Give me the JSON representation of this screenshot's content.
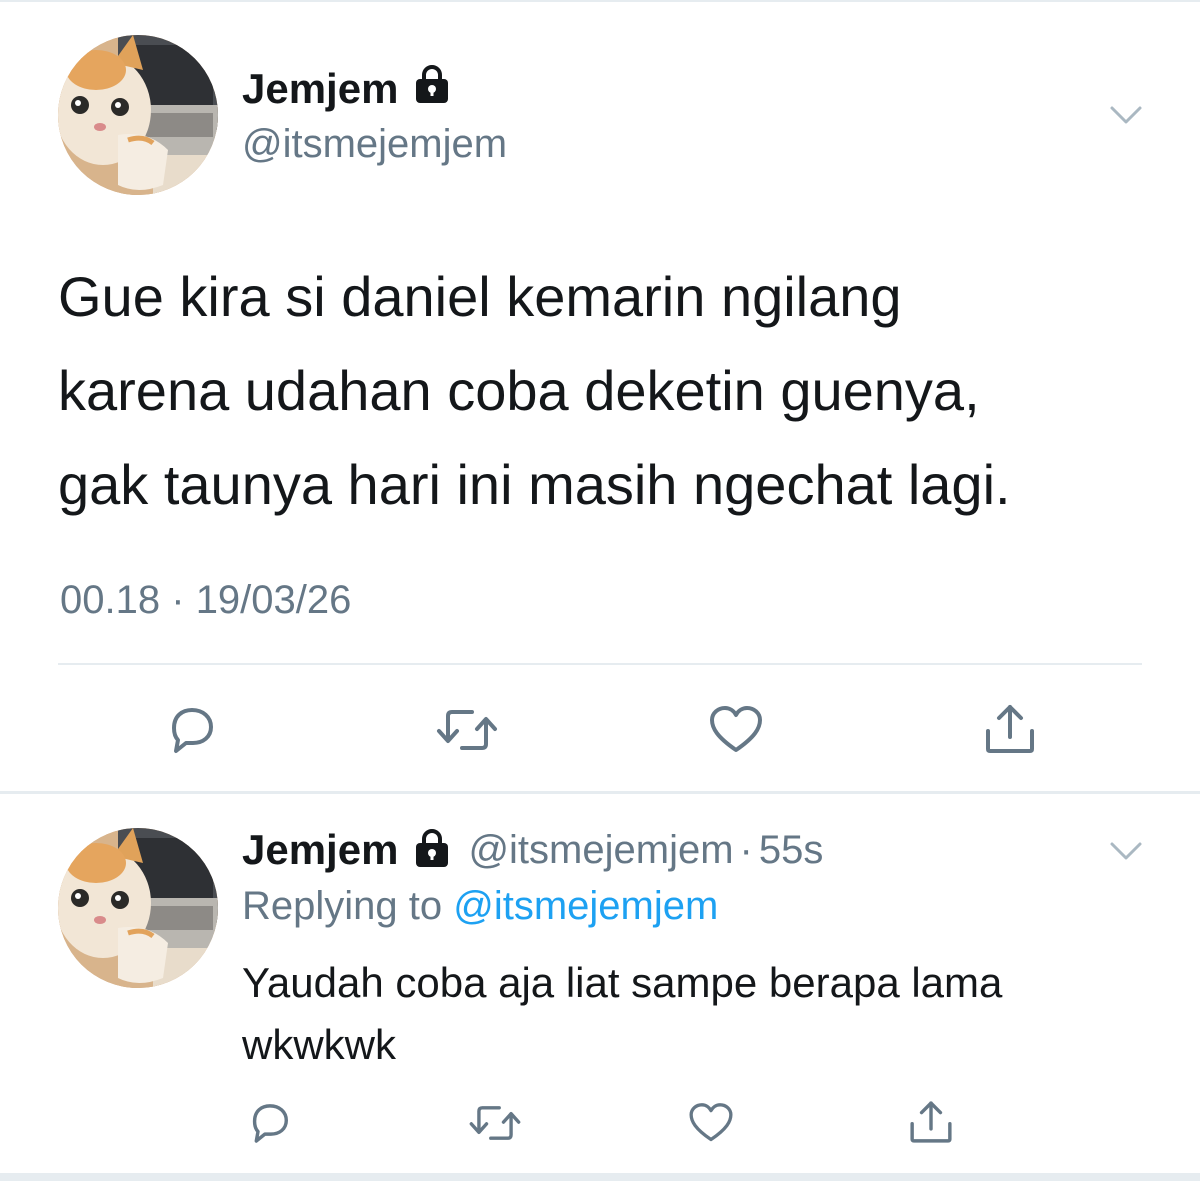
{
  "main_tweet": {
    "display_name": "Jemjem",
    "handle": "@itsmejemjem",
    "text_lines": [
      "Gue kira si daniel kemarin ngilang",
      "karena udahan coba deketin guenya,",
      "gak taunya hari ini masih ngechat lagi."
    ],
    "time": "00.18",
    "separator": "·",
    "date": "19/03/26",
    "icons": {
      "avatar": "cat-at-laptop-avatar",
      "lock": "lock-icon",
      "menu": "chevron-down-icon",
      "reply": "reply-icon",
      "retweet": "retweet-icon",
      "like": "heart-icon",
      "share": "share-icon"
    }
  },
  "reply_tweet": {
    "display_name": "Jemjem",
    "handle": "@itsmejemjem",
    "separator": "·",
    "time_ago": "55s",
    "replying_prefix": "Replying to",
    "replying_to": "@itsmejemjem",
    "text_lines": [
      "Yaudah coba aja liat sampe berapa lama",
      "wkwkwk"
    ]
  },
  "colors": {
    "text": "#14171a",
    "secondary": "#657786",
    "link": "#1da1f2",
    "divider": "#e6ecf0"
  }
}
